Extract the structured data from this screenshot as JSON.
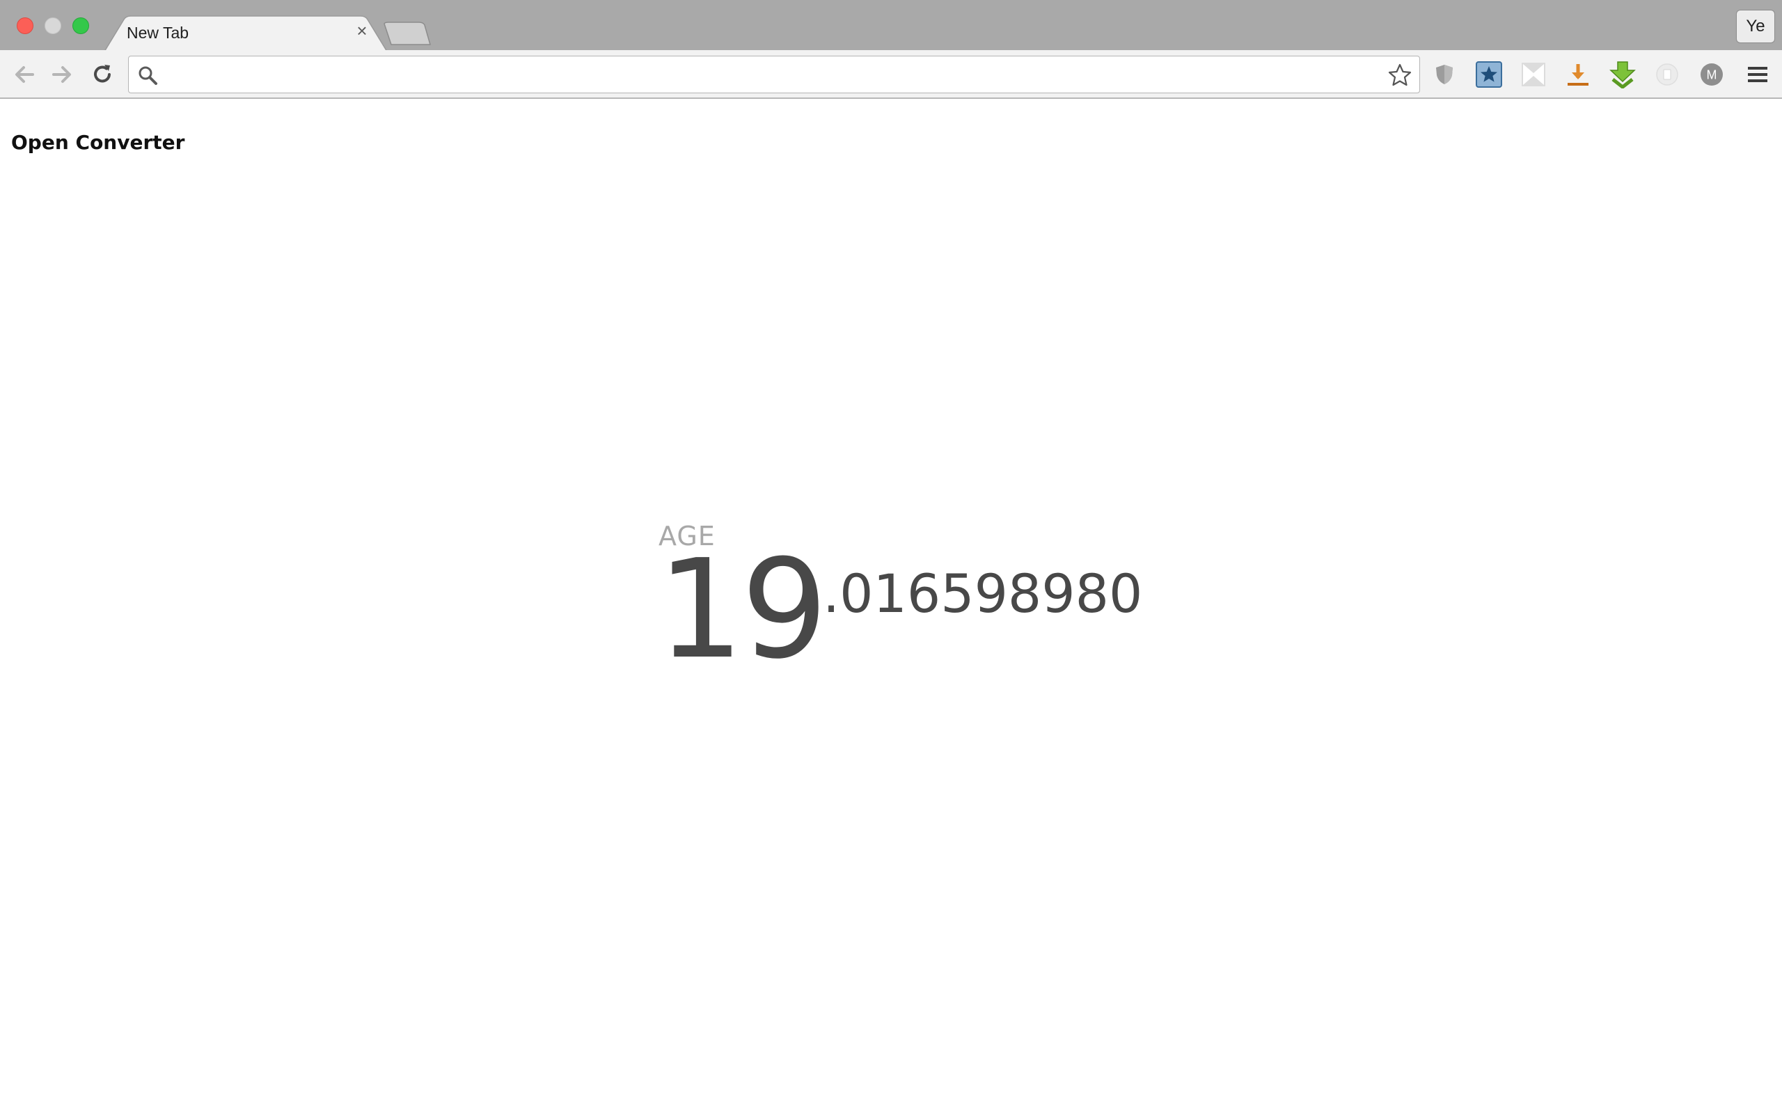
{
  "window": {
    "tab_title": "New Tab",
    "tab_close_glyph": "×",
    "profile_label": "Ye"
  },
  "toolbar": {
    "address_value": "",
    "address_placeholder": "",
    "extensions": [
      "shield-icon",
      "bookmark-star-icon",
      "bow-tie-icon",
      "download-icon",
      "green-arrow-icon",
      "circle-extension-icon",
      "m-avatar-icon",
      "menu-icon"
    ],
    "extension_m_letter": "M"
  },
  "page": {
    "link_label": "Open Converter",
    "age_label": "AGE",
    "age_integer": "19",
    "age_fraction": ".016598980"
  },
  "colors": {
    "tabstrip": "#a9a9a9",
    "toolbar": "#f2f2f2",
    "age_text": "#484848",
    "age_label": "#a8a8a8"
  }
}
